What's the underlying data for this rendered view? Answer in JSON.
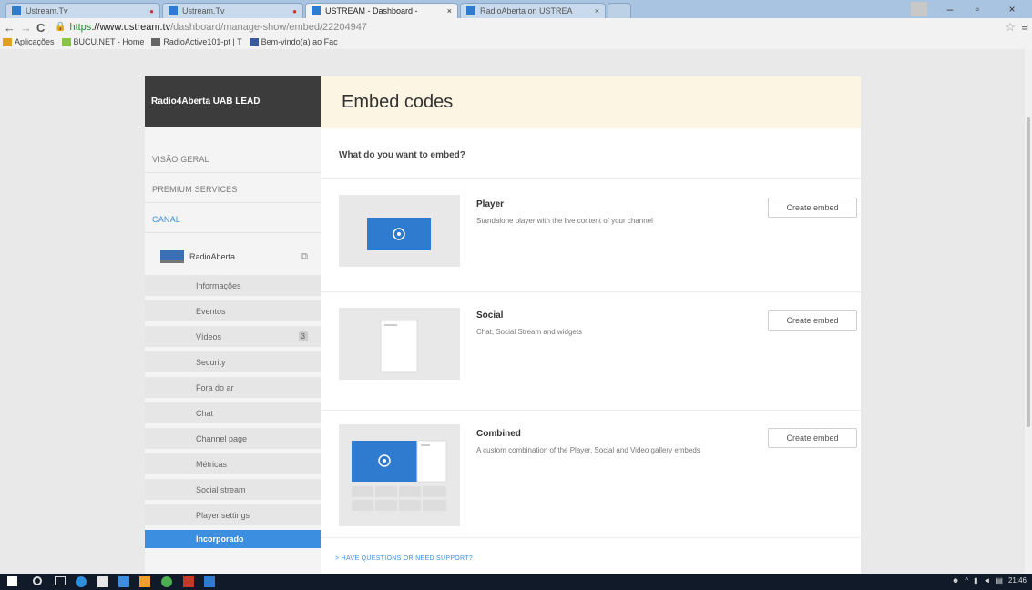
{
  "browser": {
    "tabs": [
      {
        "title": "Ustream.Tv",
        "active": false,
        "recording": true
      },
      {
        "title": "Ustream.Tv",
        "active": false,
        "recording": true
      },
      {
        "title": "USTREAM - Dashboard -",
        "active": true,
        "recording": false
      },
      {
        "title": "RadioAberta on USTREA",
        "active": false,
        "recording": false
      }
    ],
    "url_scheme": "https",
    "url_host": "://www.ustream.tv",
    "url_path": "/dashboard/manage-show/embed/22204947",
    "bookmarks": [
      {
        "label": "Aplicações",
        "color": "#e0a020"
      },
      {
        "label": "BUCU.NET - Home",
        "color": "#8bc34a"
      },
      {
        "label": "RadioActive101-pt | T",
        "color": "#666666"
      },
      {
        "label": "Bem-vindo(a) ao Fac",
        "color": "#3b5998"
      }
    ]
  },
  "sidebar": {
    "channel_header": "Radio4Aberta UAB LEAD",
    "top_items": [
      "VISÃO GERAL",
      "PREMIUM SERVICES",
      "CANAL"
    ],
    "channel_name": "RadioAberta",
    "sub_items": [
      {
        "label": "Informações",
        "count": ""
      },
      {
        "label": "Eventos",
        "count": ""
      },
      {
        "label": "Vídeos",
        "count": "3"
      },
      {
        "label": "Security",
        "count": ""
      },
      {
        "label": "Fora do ar",
        "count": ""
      },
      {
        "label": "Chat",
        "count": ""
      },
      {
        "label": "Channel page",
        "count": ""
      },
      {
        "label": "Métricas",
        "count": ""
      },
      {
        "label": "Social stream",
        "count": ""
      },
      {
        "label": "Player settings",
        "count": ""
      },
      {
        "label": "Incorporado",
        "count": "",
        "active": true
      }
    ]
  },
  "main": {
    "title": "Embed codes",
    "question": "What do you want to embed?",
    "cards": [
      {
        "title": "Player",
        "description": "Standalone player with the live content of your channel",
        "button": "Create embed"
      },
      {
        "title": "Social",
        "description": "Chat, Social Stream and widgets",
        "button": "Create embed"
      },
      {
        "title": "Combined",
        "description": "A custom combination of the Player, Social and Video gallery embeds",
        "button": "Create embed"
      }
    ],
    "support_link": "> HAVE QUESTIONS OR NEED SUPPORT?"
  },
  "taskbar": {
    "clock": "21:46"
  },
  "colors": {
    "accent": "#3b8ee0",
    "header_dark": "#3c3c3c",
    "title_bg": "#fcf5e4"
  }
}
